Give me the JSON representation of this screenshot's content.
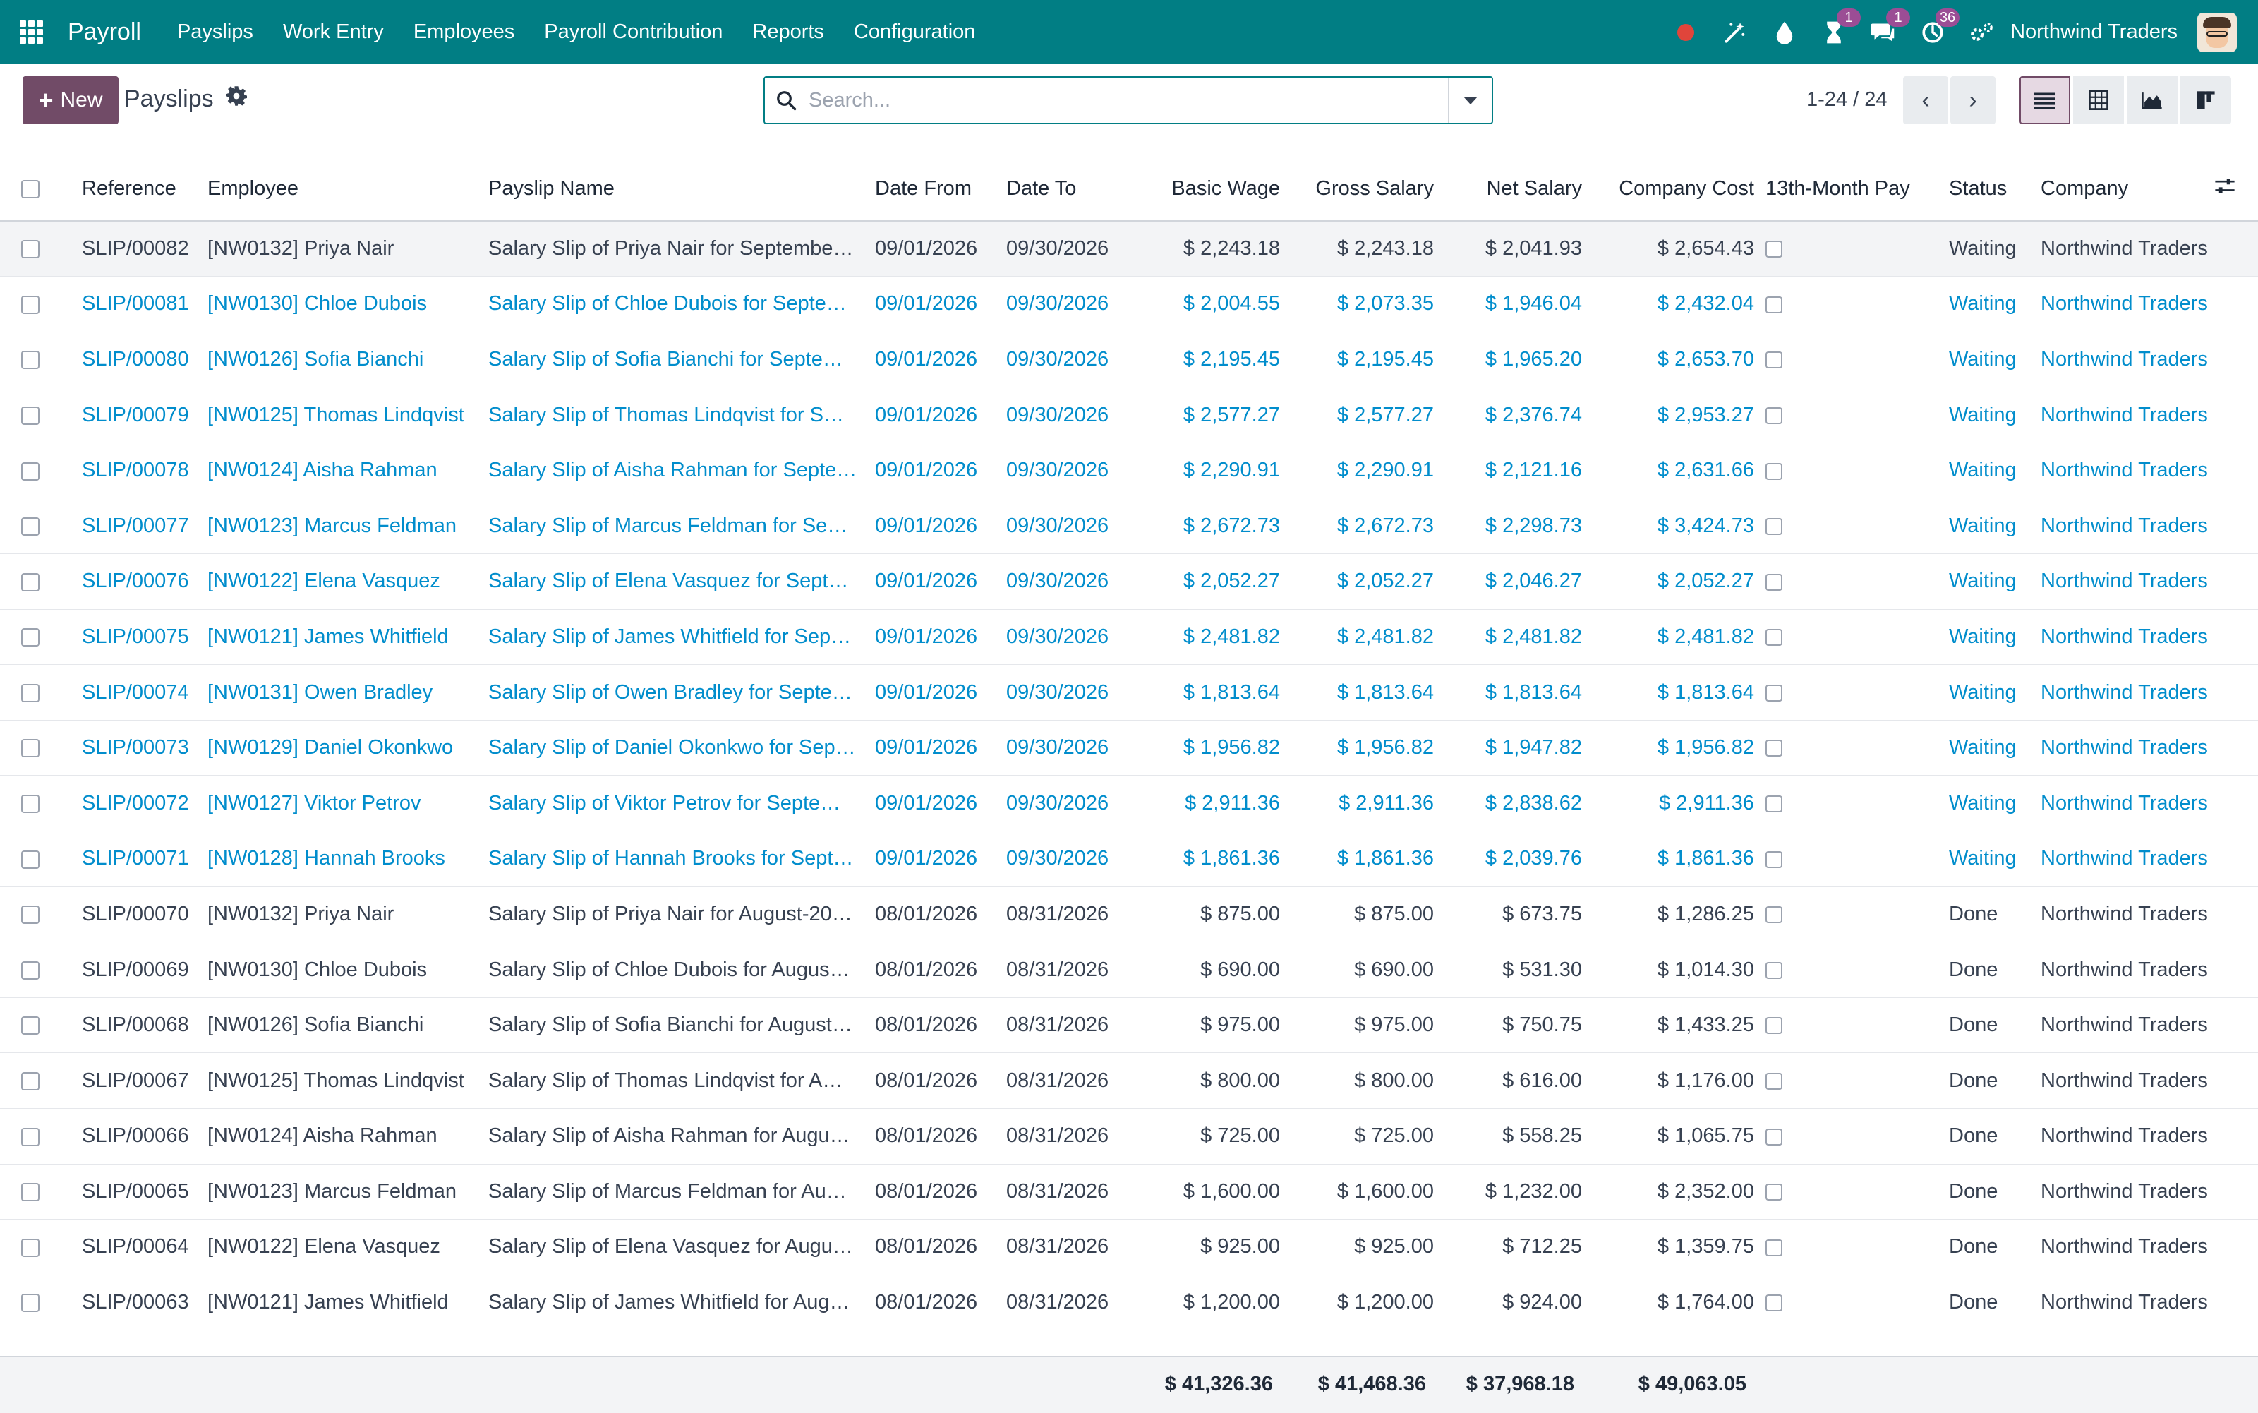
{
  "navbar": {
    "app_name": "Payroll",
    "menu": [
      "Payslips",
      "Work Entry",
      "Employees",
      "Payroll Contribution",
      "Reports",
      "Configuration"
    ],
    "badges": {
      "activities": "1",
      "messages": "1",
      "timer": "36"
    },
    "company": "Northwind Traders"
  },
  "control": {
    "new_label": "New",
    "title": "Payslips",
    "search_placeholder": "Search...",
    "pager": "1-24 / 24"
  },
  "columns": [
    "Reference",
    "Employee",
    "Payslip Name",
    "Date From",
    "Date To",
    "Basic Wage",
    "Gross Salary",
    "Net Salary",
    "Company Cost",
    "13th-Month Pay",
    "Status",
    "Company"
  ],
  "rows": [
    {
      "ref": "SLIP/00082",
      "emp": "[NW0132] Priya Nair",
      "name": "Salary Slip of Priya Nair for Septembe…",
      "from": "09/01/2026",
      "to": "09/30/2026",
      "basic": "$ 2,243.18",
      "gross": "$ 2,243.18",
      "net": "$ 2,041.93",
      "cost": "$ 2,654.43",
      "status": "Waiting",
      "company": "Northwind Traders"
    },
    {
      "ref": "SLIP/00081",
      "emp": "[NW0130] Chloe Dubois",
      "name": "Salary Slip of Chloe Dubois for Septe…",
      "from": "09/01/2026",
      "to": "09/30/2026",
      "basic": "$ 2,004.55",
      "gross": "$ 2,073.35",
      "net": "$ 1,946.04",
      "cost": "$ 2,432.04",
      "status": "Waiting",
      "company": "Northwind Traders"
    },
    {
      "ref": "SLIP/00080",
      "emp": "[NW0126] Sofia Bianchi",
      "name": "Salary Slip of Sofia Bianchi for Septe…",
      "from": "09/01/2026",
      "to": "09/30/2026",
      "basic": "$ 2,195.45",
      "gross": "$ 2,195.45",
      "net": "$ 1,965.20",
      "cost": "$ 2,653.70",
      "status": "Waiting",
      "company": "Northwind Traders"
    },
    {
      "ref": "SLIP/00079",
      "emp": "[NW0125] Thomas Lindqvist",
      "name": "Salary Slip of Thomas Lindqvist for S…",
      "from": "09/01/2026",
      "to": "09/30/2026",
      "basic": "$ 2,577.27",
      "gross": "$ 2,577.27",
      "net": "$ 2,376.74",
      "cost": "$ 2,953.27",
      "status": "Waiting",
      "company": "Northwind Traders"
    },
    {
      "ref": "SLIP/00078",
      "emp": "[NW0124] Aisha Rahman",
      "name": "Salary Slip of Aisha Rahman for Septe…",
      "from": "09/01/2026",
      "to": "09/30/2026",
      "basic": "$ 2,290.91",
      "gross": "$ 2,290.91",
      "net": "$ 2,121.16",
      "cost": "$ 2,631.66",
      "status": "Waiting",
      "company": "Northwind Traders"
    },
    {
      "ref": "SLIP/00077",
      "emp": "[NW0123] Marcus Feldman",
      "name": "Salary Slip of Marcus Feldman for Se…",
      "from": "09/01/2026",
      "to": "09/30/2026",
      "basic": "$ 2,672.73",
      "gross": "$ 2,672.73",
      "net": "$ 2,298.73",
      "cost": "$ 3,424.73",
      "status": "Waiting",
      "company": "Northwind Traders"
    },
    {
      "ref": "SLIP/00076",
      "emp": "[NW0122] Elena Vasquez",
      "name": "Salary Slip of Elena Vasquez for Sept…",
      "from": "09/01/2026",
      "to": "09/30/2026",
      "basic": "$ 2,052.27",
      "gross": "$ 2,052.27",
      "net": "$ 2,046.27",
      "cost": "$ 2,052.27",
      "status": "Waiting",
      "company": "Northwind Traders"
    },
    {
      "ref": "SLIP/00075",
      "emp": "[NW0121] James Whitfield",
      "name": "Salary Slip of James Whitfield for Sep…",
      "from": "09/01/2026",
      "to": "09/30/2026",
      "basic": "$ 2,481.82",
      "gross": "$ 2,481.82",
      "net": "$ 2,481.82",
      "cost": "$ 2,481.82",
      "status": "Waiting",
      "company": "Northwind Traders"
    },
    {
      "ref": "SLIP/00074",
      "emp": "[NW0131] Owen Bradley",
      "name": "Salary Slip of Owen Bradley for Septe…",
      "from": "09/01/2026",
      "to": "09/30/2026",
      "basic": "$ 1,813.64",
      "gross": "$ 1,813.64",
      "net": "$ 1,813.64",
      "cost": "$ 1,813.64",
      "status": "Waiting",
      "company": "Northwind Traders"
    },
    {
      "ref": "SLIP/00073",
      "emp": "[NW0129] Daniel Okonkwo",
      "name": "Salary Slip of Daniel Okonkwo for Sep…",
      "from": "09/01/2026",
      "to": "09/30/2026",
      "basic": "$ 1,956.82",
      "gross": "$ 1,956.82",
      "net": "$ 1,947.82",
      "cost": "$ 1,956.82",
      "status": "Waiting",
      "company": "Northwind Traders"
    },
    {
      "ref": "SLIP/00072",
      "emp": "[NW0127] Viktor Petrov",
      "name": "Salary Slip of Viktor Petrov for Septe…",
      "from": "09/01/2026",
      "to": "09/30/2026",
      "basic": "$ 2,911.36",
      "gross": "$ 2,911.36",
      "net": "$ 2,838.62",
      "cost": "$ 2,911.36",
      "status": "Waiting",
      "company": "Northwind Traders"
    },
    {
      "ref": "SLIP/00071",
      "emp": "[NW0128] Hannah Brooks",
      "name": "Salary Slip of Hannah Brooks for Sept…",
      "from": "09/01/2026",
      "to": "09/30/2026",
      "basic": "$ 1,861.36",
      "gross": "$ 1,861.36",
      "net": "$ 2,039.76",
      "cost": "$ 1,861.36",
      "status": "Waiting",
      "company": "Northwind Traders"
    },
    {
      "ref": "SLIP/00070",
      "emp": "[NW0132] Priya Nair",
      "name": "Salary Slip of Priya Nair for August-20…",
      "from": "08/01/2026",
      "to": "08/31/2026",
      "basic": "$ 875.00",
      "gross": "$ 875.00",
      "net": "$ 673.75",
      "cost": "$ 1,286.25",
      "status": "Done",
      "company": "Northwind Traders"
    },
    {
      "ref": "SLIP/00069",
      "emp": "[NW0130] Chloe Dubois",
      "name": "Salary Slip of Chloe Dubois for Augus…",
      "from": "08/01/2026",
      "to": "08/31/2026",
      "basic": "$ 690.00",
      "gross": "$ 690.00",
      "net": "$ 531.30",
      "cost": "$ 1,014.30",
      "status": "Done",
      "company": "Northwind Traders"
    },
    {
      "ref": "SLIP/00068",
      "emp": "[NW0126] Sofia Bianchi",
      "name": "Salary Slip of Sofia Bianchi for August…",
      "from": "08/01/2026",
      "to": "08/31/2026",
      "basic": "$ 975.00",
      "gross": "$ 975.00",
      "net": "$ 750.75",
      "cost": "$ 1,433.25",
      "status": "Done",
      "company": "Northwind Traders"
    },
    {
      "ref": "SLIP/00067",
      "emp": "[NW0125] Thomas Lindqvist",
      "name": "Salary Slip of Thomas Lindqvist for A…",
      "from": "08/01/2026",
      "to": "08/31/2026",
      "basic": "$ 800.00",
      "gross": "$ 800.00",
      "net": "$ 616.00",
      "cost": "$ 1,176.00",
      "status": "Done",
      "company": "Northwind Traders"
    },
    {
      "ref": "SLIP/00066",
      "emp": "[NW0124] Aisha Rahman",
      "name": "Salary Slip of Aisha Rahman for Augu…",
      "from": "08/01/2026",
      "to": "08/31/2026",
      "basic": "$ 725.00",
      "gross": "$ 725.00",
      "net": "$ 558.25",
      "cost": "$ 1,065.75",
      "status": "Done",
      "company": "Northwind Traders"
    },
    {
      "ref": "SLIP/00065",
      "emp": "[NW0123] Marcus Feldman",
      "name": "Salary Slip of Marcus Feldman for Au…",
      "from": "08/01/2026",
      "to": "08/31/2026",
      "basic": "$ 1,600.00",
      "gross": "$ 1,600.00",
      "net": "$ 1,232.00",
      "cost": "$ 2,352.00",
      "status": "Done",
      "company": "Northwind Traders"
    },
    {
      "ref": "SLIP/00064",
      "emp": "[NW0122] Elena Vasquez",
      "name": "Salary Slip of Elena Vasquez for Augu…",
      "from": "08/01/2026",
      "to": "08/31/2026",
      "basic": "$ 925.00",
      "gross": "$ 925.00",
      "net": "$ 712.25",
      "cost": "$ 1,359.75",
      "status": "Done",
      "company": "Northwind Traders"
    },
    {
      "ref": "SLIP/00063",
      "emp": "[NW0121] James Whitfield",
      "name": "Salary Slip of James Whitfield for Aug…",
      "from": "08/01/2026",
      "to": "08/31/2026",
      "basic": "$ 1,200.00",
      "gross": "$ 1,200.00",
      "net": "$ 924.00",
      "cost": "$ 1,764.00",
      "status": "Done",
      "company": "Northwind Traders"
    }
  ],
  "totals": {
    "basic": "$ 41,326.36",
    "gross": "$ 41,468.36",
    "net": "$ 37,968.18",
    "cost": "$ 49,063.05"
  },
  "colors": {
    "navbar": "#017e84",
    "primary": "#714b67",
    "link": "#018dcc"
  }
}
